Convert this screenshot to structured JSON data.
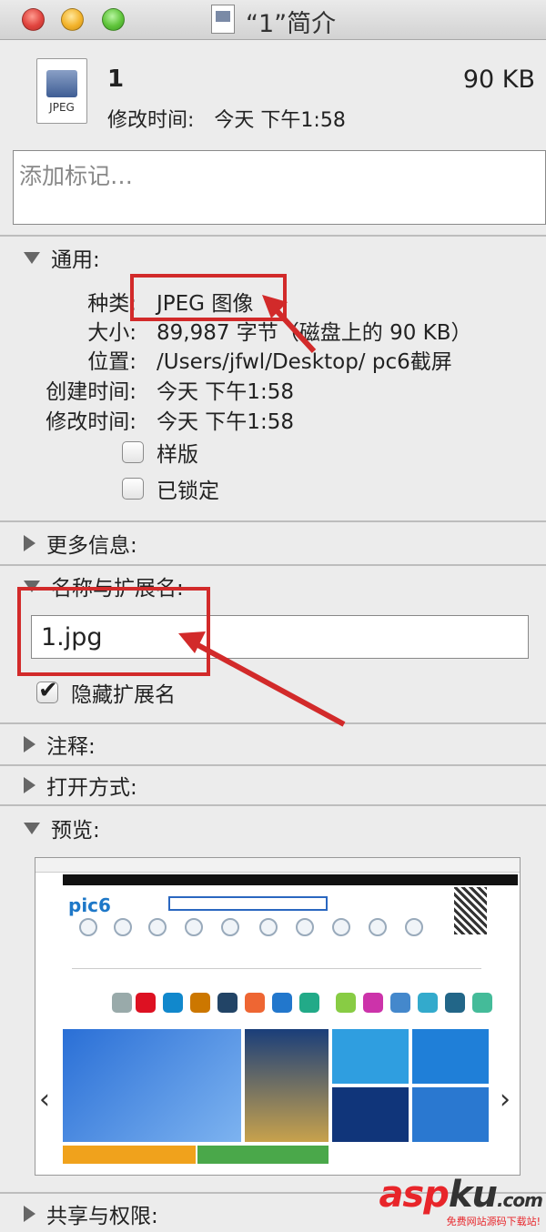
{
  "window": {
    "title": "“1”简介"
  },
  "file": {
    "icon_label": "JPEG",
    "name": "1",
    "size": "90 KB",
    "modified_label": "修改时间:",
    "modified_value": "今天 下午1:58"
  },
  "tags": {
    "placeholder": "添加标记…"
  },
  "general": {
    "header": "通用:",
    "rows": [
      {
        "label": "种类:",
        "value": "JPEG 图像"
      },
      {
        "label": "大小:",
        "value": "89,987 字节（磁盘上的 90 KB）"
      },
      {
        "label": "位置:",
        "value": "/Users/jfwl/Desktop/ pc6截屏"
      },
      {
        "label": "创建时间:",
        "value": "今天 下午1:58"
      },
      {
        "label": "修改时间:",
        "value": "今天 下午1:58"
      }
    ],
    "stationery_label": "样版",
    "locked_label": "已锁定"
  },
  "more_info": {
    "header": "更多信息:"
  },
  "name_ext": {
    "header": "名称与扩展名:",
    "value": "1.jpg",
    "hide_ext_label": "隐藏扩展名",
    "hide_ext_checked": true
  },
  "comments": {
    "header": "注释:"
  },
  "open_with": {
    "header": "打开方式:"
  },
  "preview": {
    "header": "预览:",
    "logo": "pic6"
  },
  "sharing": {
    "header": "共享与权限:"
  },
  "watermark": {
    "part_a": "asp",
    "part_b": "ku",
    "suffix": ".com",
    "tagline": "免费网站源码下载站!"
  },
  "colors": {
    "annotation_red": "#d22a2a",
    "accent_blue": "#1e78c8"
  }
}
